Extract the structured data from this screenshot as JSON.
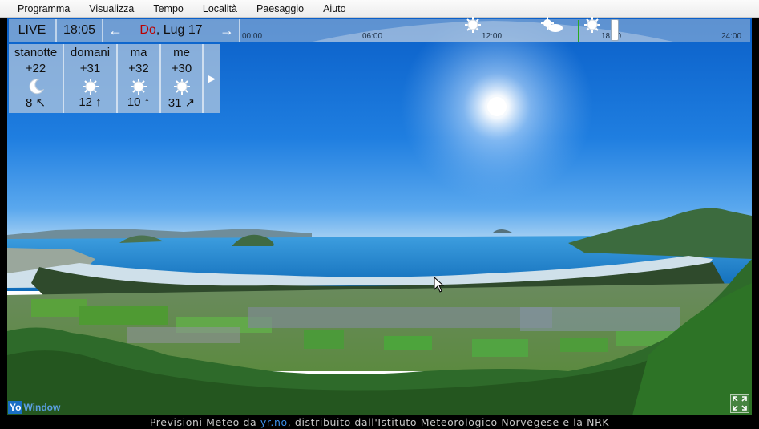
{
  "menu": [
    "Programma",
    "Visualizza",
    "Tempo",
    "Località",
    "Paesaggio",
    "Aiuto"
  ],
  "topbar": {
    "live_label": "LIVE",
    "time": "18:05",
    "date_day": "Do",
    "date_rest": ", Lug 17",
    "prev_icon": "arrow-left-icon",
    "next_icon": "arrow-right-icon"
  },
  "timeline": {
    "ticks": [
      "00:00",
      "06:00",
      "12:00",
      "18:00",
      "24:00"
    ],
    "current_time": "18:05",
    "icons": [
      "sun-icon",
      "sun-cloud-icon",
      "sun-icon"
    ]
  },
  "forecast": [
    {
      "day": "stanotte",
      "temp": "+22",
      "icon": "moon-icon",
      "wind": "8 ↖"
    },
    {
      "day": "domani",
      "temp": "+31",
      "icon": "sun-icon",
      "wind": "12 ↑"
    },
    {
      "day": "ma",
      "temp": "+32",
      "icon": "sun-icon",
      "wind": "10 ↑"
    },
    {
      "day": "me",
      "temp": "+30",
      "icon": "sun-icon",
      "wind": "31 ↗"
    }
  ],
  "forecast_next_icon": "play-right-icon",
  "logo": {
    "yo": "Yo",
    "rest": "Window"
  },
  "credits": {
    "prefix": "Previsioni Meteo da ",
    "link": "yr.no",
    "suffix": ", distribuito dall'Istituto Meteorologico Norvegese e la NRK"
  }
}
